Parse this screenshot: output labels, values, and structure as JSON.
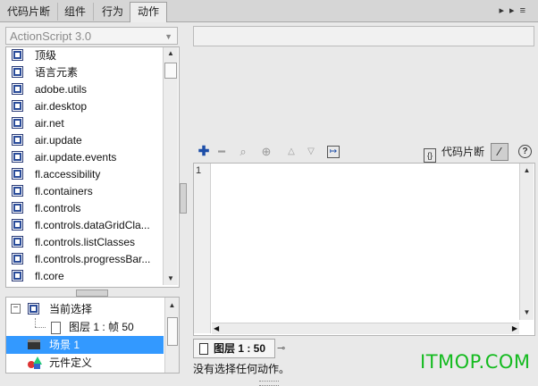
{
  "tabs": [
    {
      "label": "代码片断"
    },
    {
      "label": "组件"
    },
    {
      "label": "行为"
    },
    {
      "label": "动作",
      "active": true
    }
  ],
  "language_select": {
    "value": "ActionScript 3.0"
  },
  "tree_items": [
    {
      "label": "顶级"
    },
    {
      "label": "语言元素"
    },
    {
      "label": "adobe.utils"
    },
    {
      "label": "air.desktop"
    },
    {
      "label": "air.net"
    },
    {
      "label": "air.update"
    },
    {
      "label": "air.update.events"
    },
    {
      "label": "fl.accessibility"
    },
    {
      "label": "fl.containers"
    },
    {
      "label": "fl.controls"
    },
    {
      "label": "fl.controls.dataGridCla..."
    },
    {
      "label": "fl.controls.listClasses"
    },
    {
      "label": "fl.controls.progressBar..."
    },
    {
      "label": "fl.core"
    }
  ],
  "scene_tree": {
    "current_selection": "当前选择",
    "layer_frame": "图层 1 : 帧 50",
    "scene": "场景 1",
    "symbol_def": "元件定义"
  },
  "toolbar": {
    "snippet_label": "代码片断"
  },
  "editor": {
    "line_number": "1"
  },
  "bottom_tab": {
    "label": "图层 1 : 50"
  },
  "status": {
    "text": "没有选择任何动作。"
  },
  "watermark": {
    "text": "ITMOP.COM"
  },
  "colors": {
    "selection": "#3399ff",
    "watermark": "#15bb20",
    "icon_blue": "#2a4c9a"
  }
}
